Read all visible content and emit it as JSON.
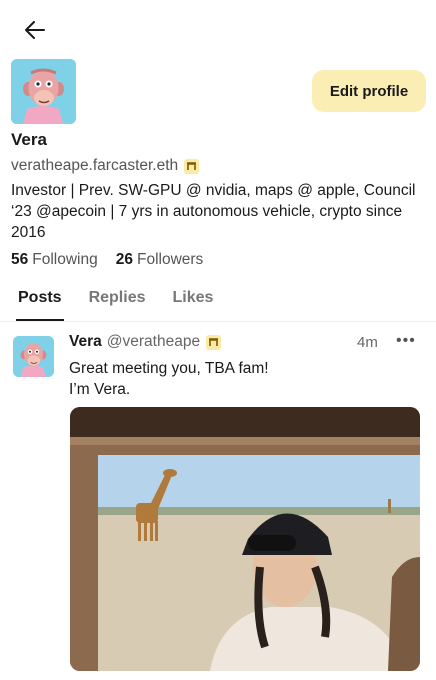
{
  "nav": {
    "back_icon": "arrow-left-icon"
  },
  "profile": {
    "avatar_icon": "ape-avatar",
    "name": "Vera",
    "handle": "veratheape.farcaster.eth",
    "badge_icon": "power-badge-icon",
    "bio": "Investor | Prev. SW-GPU @ nvidia, maps @ apple, Council ‘23 @apecoin | 7 yrs in autonomous vehicle, crypto since 2016",
    "edit_label": "Edit profile",
    "following_count": "56",
    "following_label": "Following",
    "followers_count": "26",
    "followers_label": "Followers"
  },
  "tabs": [
    {
      "label": "Posts",
      "active": true
    },
    {
      "label": "Replies",
      "active": false
    },
    {
      "label": "Likes",
      "active": false
    }
  ],
  "post": {
    "author_name": "Vera",
    "author_handle": "@veratheape",
    "time": "4m",
    "more_label": "•••",
    "line1": "Great meeting you, TBA fam!",
    "line2": "I’m Vera.",
    "image_icon": "photo-giraffe-safari"
  },
  "colors": {
    "accent": "#fbeeb4",
    "avatar_bg": "#7fd1e8",
    "text": "#1a1a1a",
    "muted": "#555555"
  }
}
